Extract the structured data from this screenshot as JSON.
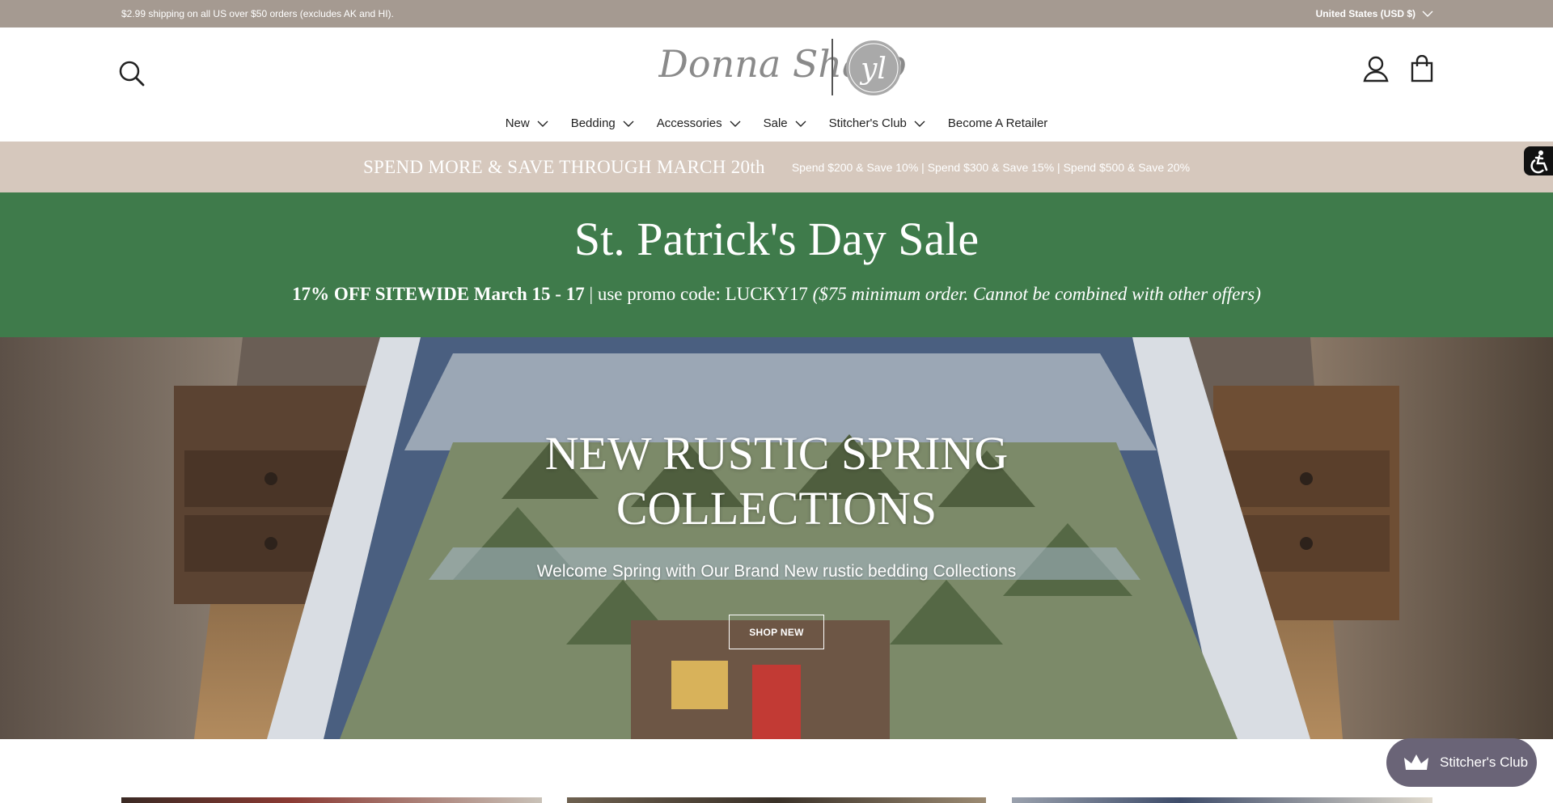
{
  "announcement": {
    "shipping_text": "$2.99 shipping on all US over $50 orders (excludes AK and HI).",
    "region_label": "United States (USD $)"
  },
  "header": {
    "logo_text": "Donna Sharp",
    "logo_badge": "yl"
  },
  "nav": {
    "items": [
      {
        "label": "New"
      },
      {
        "label": "Bedding"
      },
      {
        "label": "Accessories"
      },
      {
        "label": "Sale"
      },
      {
        "label": "Stitcher's Club"
      },
      {
        "label": "Become A Retailer"
      }
    ]
  },
  "promo": {
    "headline": "SPEND MORE & SAVE THROUGH MARCH 20th",
    "details": "Spend $200 & Save 10% | Spend $300 & Save 15% | Spend $500 & Save 20%"
  },
  "sale": {
    "title": "St. Patrick's Day Sale",
    "offer": "17% OFF SITEWIDE March 15 - 17",
    "separator": " | ",
    "code_text": "use promo code: LUCKY17 ",
    "terms": "($75 minimum order. Cannot be combined with other offers)"
  },
  "hero": {
    "heading_line1": "NEW RUSTIC SPRING",
    "heading_line2": "COLLECTIONS",
    "subheading": "Welcome Spring with Our Brand New rustic bedding Collections",
    "cta": "SHOP NEW"
  },
  "widget": {
    "label": "Stitcher's Club",
    "icon": "crown-icon"
  },
  "colors": {
    "announcement_bg": "#a59a91",
    "promo_bg": "#d6c8bd",
    "sale_bg": "#3f7b4b",
    "widget_bg": "#6a6477"
  }
}
